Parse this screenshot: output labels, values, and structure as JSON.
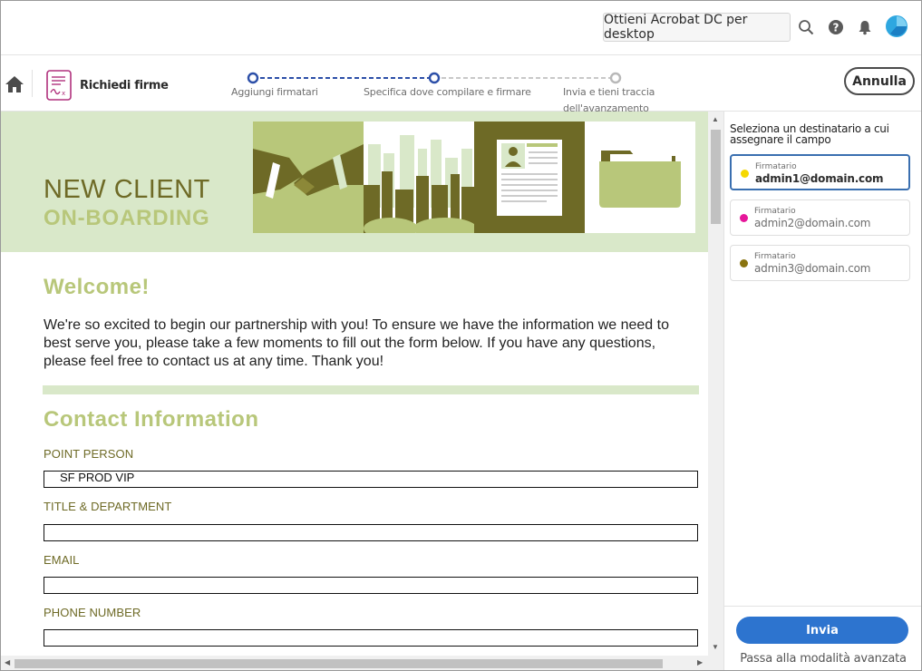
{
  "topbar": {
    "get_acrobat_label": "Ottieni Acrobat DC per desktop",
    "icons": [
      "search-icon",
      "help-icon",
      "bell-icon",
      "avatar"
    ]
  },
  "toolbar": {
    "tool_title": "Richiedi firme",
    "cancel_label": "Annulla",
    "steps": [
      {
        "label": "Aggiungi firmatari",
        "state": "done"
      },
      {
        "label": "Specifica dove compilare e firmare",
        "state": "current"
      },
      {
        "label_line1": "Invia e tieni traccia",
        "label_line2": "dell'avanzamento",
        "state": "pending"
      }
    ]
  },
  "document": {
    "banner_title_1": "NEW CLIENT",
    "banner_title_2": "ON-BOARDING",
    "welcome_heading": "Welcome!",
    "intro_text": "We're so excited to begin our partnership with you! To ensure we have the information we need to best serve you, please take a few moments to fill out the form below. If you have any questions, please feel free to contact us at any time. Thank you!",
    "section_heading": "Contact Information",
    "fields": [
      {
        "label": "POINT PERSON",
        "value": "SF PROD VIP"
      },
      {
        "label": "TITLE & DEPARTMENT",
        "value": ""
      },
      {
        "label": "EMAIL",
        "value": ""
      },
      {
        "label": "PHONE NUMBER",
        "value": ""
      }
    ],
    "colors": {
      "olive": "#6e6a26",
      "light_olive": "#b8c77a",
      "banner_bg": "#d9e8c9"
    }
  },
  "panel": {
    "title": "Seleziona un destinatario a cui assegnare il campo",
    "signers": [
      {
        "role": "Firmatario",
        "email": "admin1@domain.com",
        "color": "#f5d800",
        "selected": true
      },
      {
        "role": "Firmatario",
        "email": "admin2@domain.com",
        "color": "#e6179a",
        "selected": false
      },
      {
        "role": "Firmatario",
        "email": "admin3@domain.com",
        "color": "#8a7410",
        "selected": false
      }
    ],
    "send_label": "Invia",
    "advanced_label": "Passa alla modalità avanzata"
  }
}
